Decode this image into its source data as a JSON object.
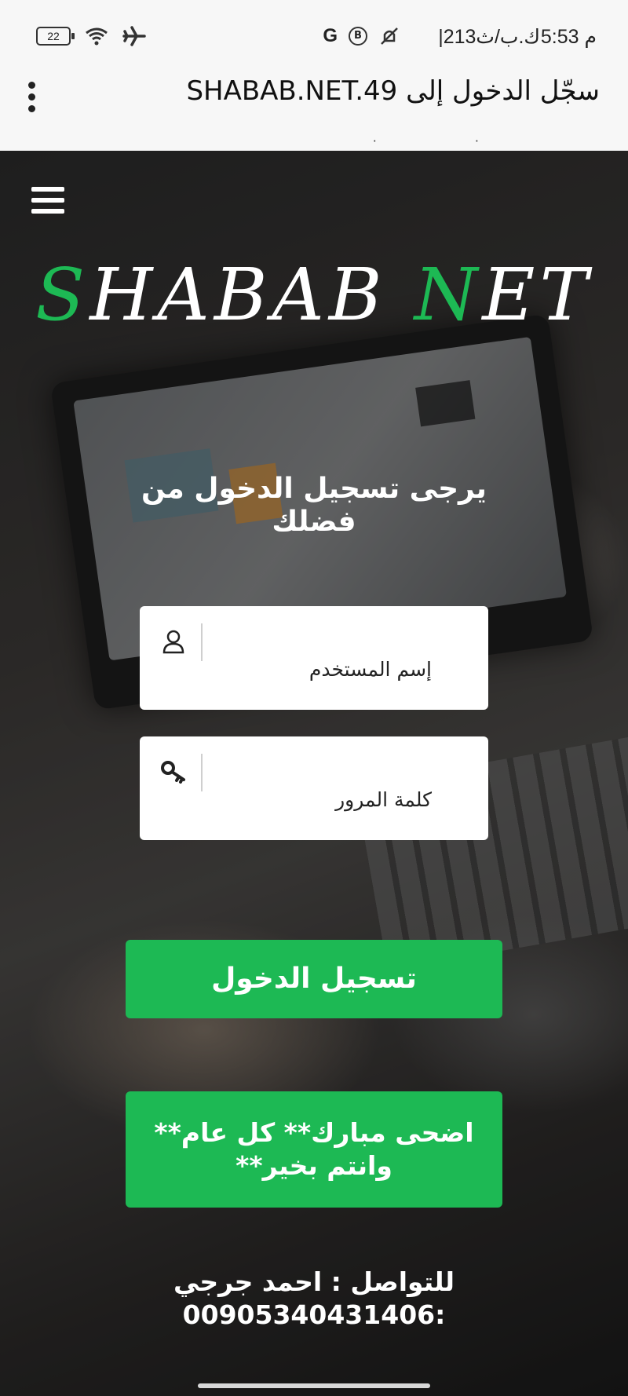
{
  "status_bar": {
    "time": "5:53 م",
    "speed": "|213ك.ب/ث",
    "battery": "22",
    "icons": [
      "mute-icon",
      "b-badge-icon",
      "google-g-icon",
      "airplane-icon",
      "wifi-icon",
      "battery-icon"
    ]
  },
  "title_bar": {
    "title": "سجّل الدخول إلى SHABAB.NET.49",
    "menu_icon": "more-vert-icon"
  },
  "page": {
    "hamburger_icon": "menu-icon",
    "logo": {
      "s": "S",
      "part1": "HABAB ",
      "n": "N",
      "part2": "ET"
    },
    "please_login": "يرجى تسجيل الدخول من فضلك",
    "username": {
      "placeholder": "إسم المستخدم",
      "icon": "user-icon"
    },
    "password": {
      "placeholder": "كلمة المرور",
      "icon": "key-icon"
    },
    "login_button": "تسجيل الدخول",
    "eid_button": "اضحى مبارك** كل عام** وانتم بخير**",
    "contact_line1": "للتواصل : احمد جرجي",
    "contact_line2": "00905340431406:"
  },
  "colors": {
    "accent": "#1db954",
    "status_bg": "#f7f7f7"
  }
}
